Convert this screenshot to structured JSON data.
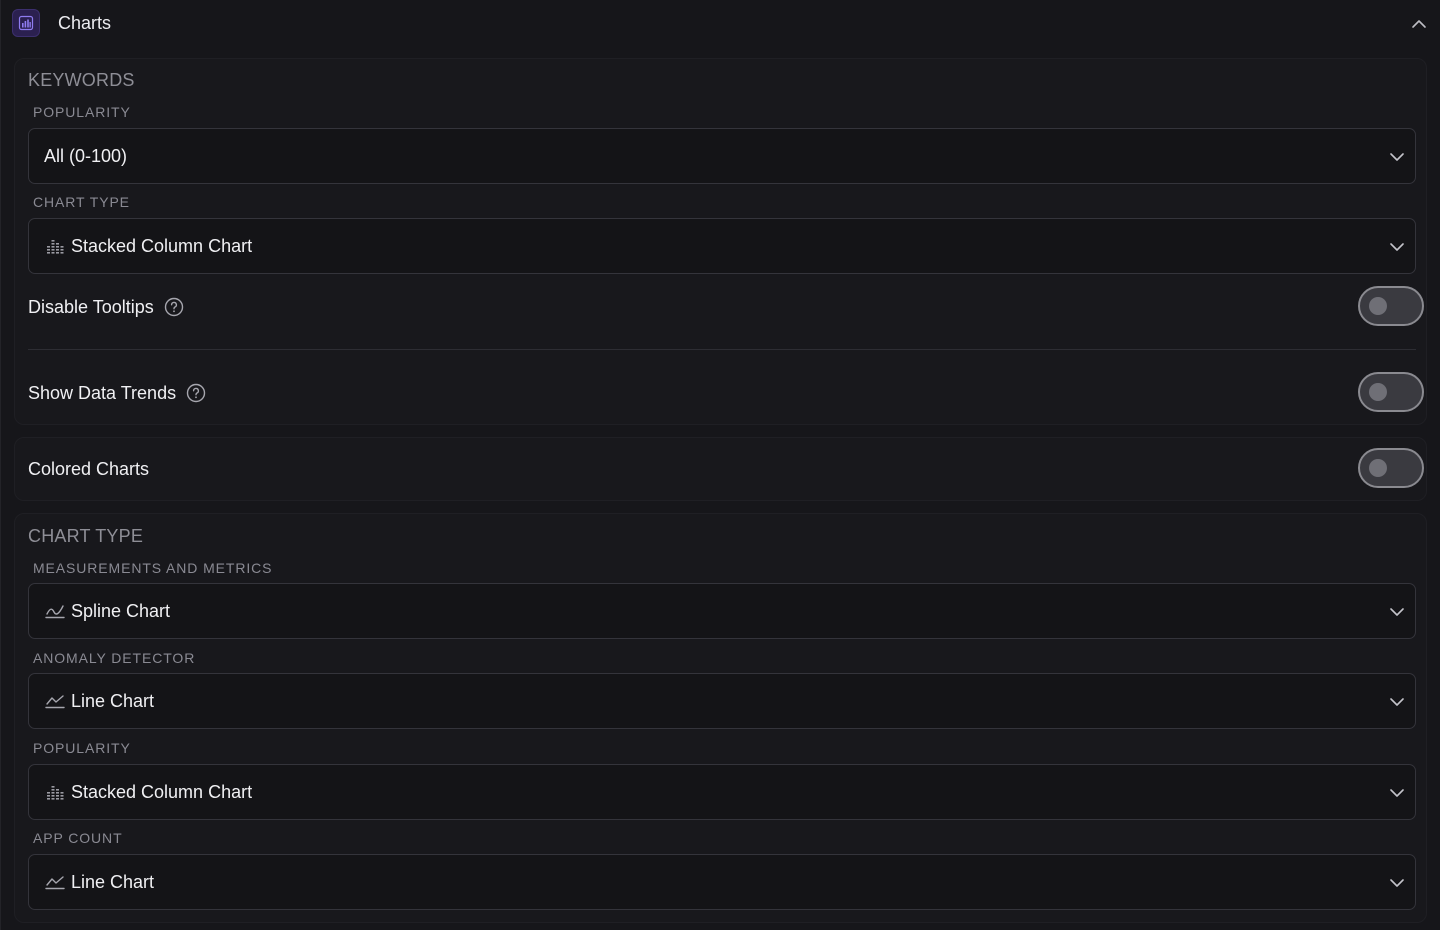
{
  "header": {
    "title": "Charts",
    "app_icon": "bar-chart-icon",
    "collapse_icon": "chevron-up-icon"
  },
  "keywords": {
    "title": "KEYWORDS",
    "popularity_label": "POPULARITY",
    "popularity_value": "All (0-100)",
    "chart_type_label": "CHART TYPE",
    "chart_type_value": "Stacked Column Chart",
    "chart_type_icon": "stacked-column-icon",
    "disable_tooltips_label": "Disable Tooltips",
    "disable_tooltips_on": false,
    "show_trends_label": "Show Data Trends",
    "show_trends_on": false
  },
  "colored": {
    "label": "Colored Charts",
    "on": false
  },
  "chart_type": {
    "title": "CHART TYPE",
    "fields": [
      {
        "label": "MEASUREMENTS AND METRICS",
        "value": "Spline Chart",
        "icon": "spline-chart-icon"
      },
      {
        "label": "ANOMALY DETECTOR",
        "value": "Line Chart",
        "icon": "line-chart-icon"
      },
      {
        "label": "POPULARITY",
        "value": "Stacked Column Chart",
        "icon": "stacked-column-icon"
      },
      {
        "label": "APP COUNT",
        "value": "Line Chart",
        "icon": "line-chart-icon"
      }
    ]
  },
  "colors": {
    "background": "#16161a",
    "accent": "#7c5ce0",
    "text": "#f0f0f3",
    "muted": "#8a8a93"
  }
}
